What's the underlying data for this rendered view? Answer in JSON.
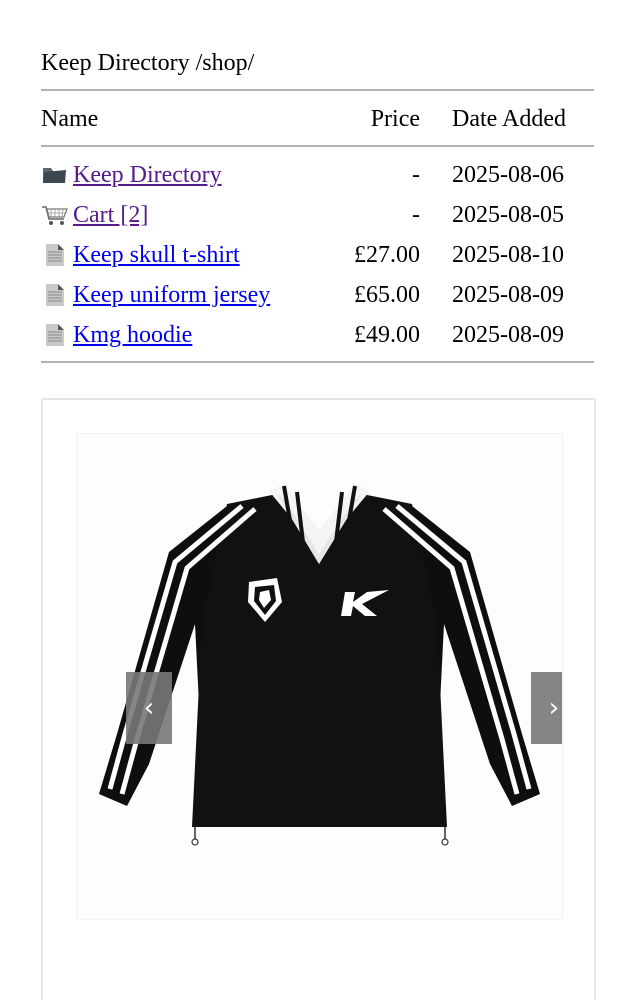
{
  "heading": "Keep Directory /shop/",
  "columns": {
    "name": "Name",
    "price": "Price",
    "date": "Date Added"
  },
  "rows": [
    {
      "icon": "folder-icon",
      "name": "Keep Directory",
      "price": "-",
      "date": "2025-08-06"
    },
    {
      "icon": "cart-icon",
      "name": "Cart [2]",
      "price": "-",
      "date": "2025-08-05"
    },
    {
      "icon": "file-icon",
      "name": "Keep skull t-shirt",
      "price": "£27.00",
      "date": "2025-08-10"
    },
    {
      "icon": "file-icon",
      "name": "Keep uniform jersey",
      "price": "£65.00",
      "date": "2025-08-09"
    },
    {
      "icon": "file-icon",
      "name": "Kmg hoodie",
      "price": "£49.00",
      "date": "2025-08-09"
    }
  ],
  "carousel": {
    "prev_label": "‹",
    "next_label": "›",
    "image_alt": "Black long-sleeve uniform jersey with white collar, crest and K logo"
  },
  "colors": {
    "link": "#0000ee",
    "visited_link": "#551a8b",
    "rule": "#b3b3b3",
    "nav_button": "#787878"
  }
}
